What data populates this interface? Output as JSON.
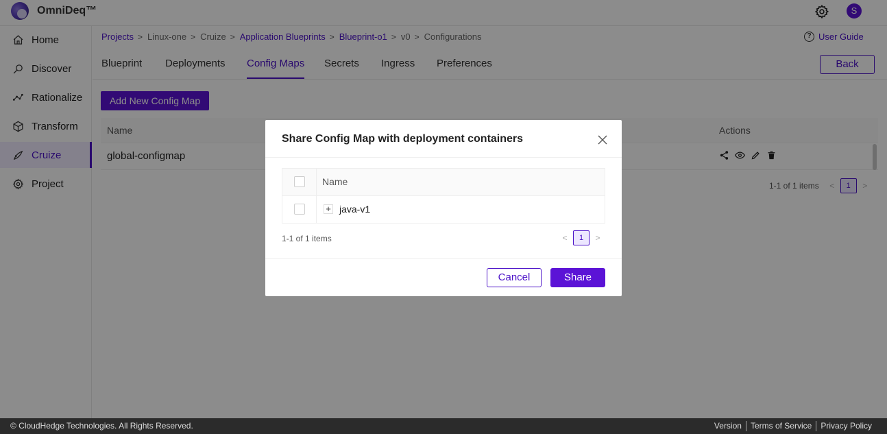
{
  "app": {
    "brand": "OmniDeq™",
    "user_initial": "S"
  },
  "sidebar": {
    "items": [
      {
        "label": "Home",
        "icon": "home-icon"
      },
      {
        "label": "Discover",
        "icon": "discover-icon"
      },
      {
        "label": "Rationalize",
        "icon": "rationalize-icon"
      },
      {
        "label": "Transform",
        "icon": "cube-icon"
      },
      {
        "label": "Cruize",
        "icon": "cruize-icon",
        "active": true
      },
      {
        "label": "Project",
        "icon": "settings-icon"
      }
    ]
  },
  "breadcrumb": [
    "Projects",
    "Linux-one",
    "Cruize",
    "Application Blueprints",
    "Blueprint-o1",
    "v0",
    "Configurations"
  ],
  "user_guide_label": "User Guide",
  "tabs": [
    "Blueprint",
    "Deployments",
    "Config Maps",
    "Secrets",
    "Ingress",
    "Preferences"
  ],
  "active_tab": "Config Maps",
  "back_label": "Back",
  "add_button_label": "Add New Config Map",
  "table": {
    "columns": [
      "Name",
      "Actions"
    ],
    "rows": [
      {
        "name": "global-configmap"
      }
    ],
    "count_text": "1-1 of 1 items",
    "page": "1"
  },
  "modal": {
    "title": "Share Config Map with deployment containers",
    "column": "Name",
    "rows": [
      {
        "name": "java-v1"
      }
    ],
    "count_text": "1-1 of 1 items",
    "page": "1",
    "cancel_label": "Cancel",
    "share_label": "Share"
  },
  "footer": {
    "copyright": "© CloudHedge Technologies. All Rights Reserved.",
    "links": [
      "Version",
      "Terms of Service",
      "Privacy Policy"
    ]
  },
  "colors": {
    "accent": "#5b13d6",
    "accent_text": "#4c12c8",
    "footer_bg": "#2b2b2b"
  }
}
